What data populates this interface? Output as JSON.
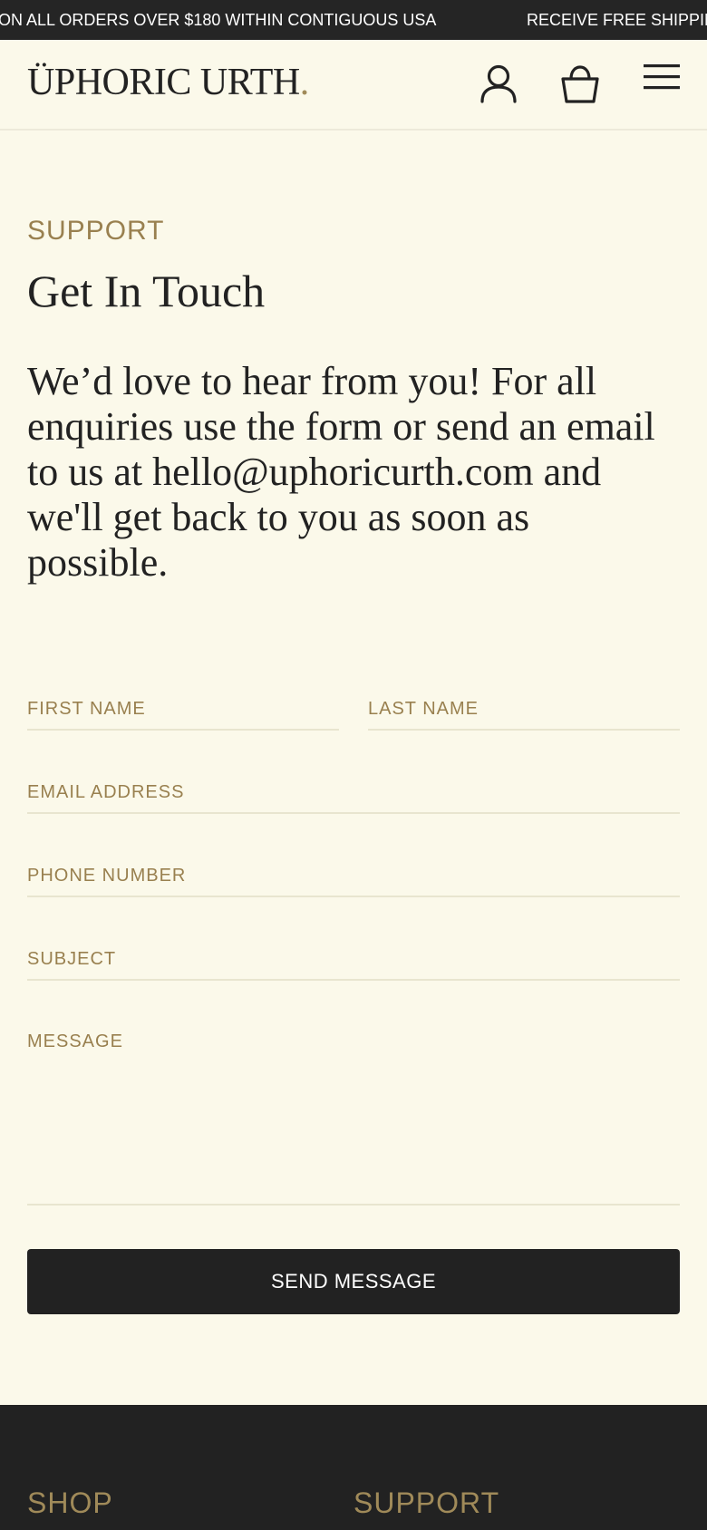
{
  "announcement": {
    "message_1": "ON ALL ORDERS OVER $180 WITHIN CONTIGUOUS USA",
    "message_2": "RECEIVE FREE SHIPPIN"
  },
  "header": {
    "logo_text": "ÜPHORIC URTH",
    "logo_dot": ".",
    "icons": {
      "account": "user-icon",
      "cart": "shopping-bag-icon",
      "menu": "hamburger-menu-icon"
    }
  },
  "page": {
    "eyebrow": "SUPPORT",
    "title": "Get In Touch",
    "intro": "We’d love to hear from you! For all enquiries use the form or send an email to us at hello@uphoricurth.com and we'll get back to you as soon as possible."
  },
  "form": {
    "first_name": {
      "value": "",
      "placeholder": "FIRST NAME"
    },
    "last_name": {
      "value": "",
      "placeholder": "LAST NAME"
    },
    "email": {
      "value": "",
      "placeholder": "EMAIL ADDRESS"
    },
    "phone": {
      "value": "",
      "placeholder": "PHONE NUMBER"
    },
    "subject": {
      "value": "",
      "placeholder": "SUBJECT"
    },
    "message": {
      "value": "",
      "placeholder": "MESSAGE"
    },
    "submit_label": "SEND MESSAGE"
  },
  "footer": {
    "col_1_heading": "SHOP",
    "col_2_heading": "SUPPORT"
  },
  "colors": {
    "background": "#FBF9EA",
    "dark": "#222222",
    "accent": "#99804F",
    "divider": "#E8E5CF"
  }
}
